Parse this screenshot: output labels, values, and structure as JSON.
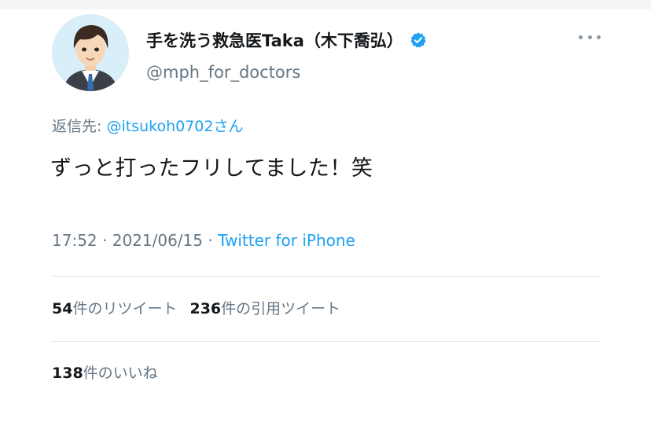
{
  "tweet": {
    "display_name": "手を洗う救急医Taka（木下喬弘）",
    "handle": "@mph_for_doctors",
    "reply_prefix": "返信先: ",
    "reply_to": "@itsukoh0702さん",
    "text": "ずっと打ったフリしてました！笑",
    "time": "17:52",
    "date": "2021/06/15",
    "separator": " · ",
    "source": "Twitter for iPhone"
  },
  "stats": {
    "retweets_count": "54",
    "retweets_label": "件のリツイート",
    "quotes_count": "236",
    "quotes_label": "件の引用ツイート",
    "likes_count": "138",
    "likes_label": "件のいいね"
  },
  "icons": {
    "verified": "verified-badge-icon",
    "more": "more-options-icon",
    "avatar": "avatar-illustration"
  },
  "colors": {
    "link": "#1da1f2",
    "secondary_text": "#657786",
    "primary_text": "#14171a",
    "divider": "#e1e8ed"
  }
}
